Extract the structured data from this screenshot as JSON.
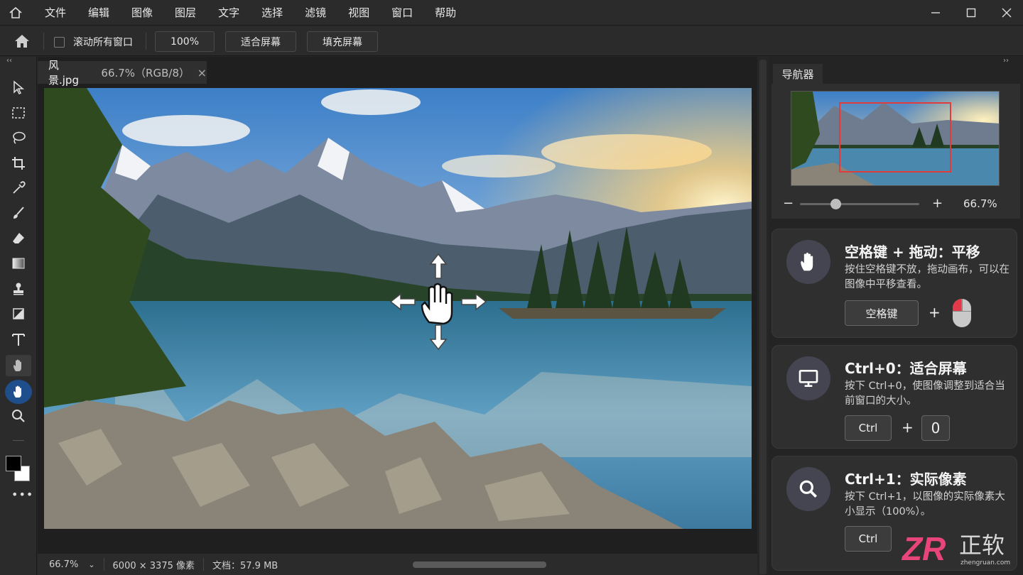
{
  "menubar": {
    "items": [
      "文件",
      "编辑",
      "图像",
      "图层",
      "文字",
      "选择",
      "滤镜",
      "视图",
      "窗口",
      "帮助"
    ]
  },
  "options": {
    "scroll_all_label": "滚动所有窗口",
    "zoom_value": "100%",
    "fit_screen_label": "适合屏幕",
    "fill_screen_label": "填充屏幕"
  },
  "document": {
    "tab_name": "风景.jpg",
    "tab_info": "66.7%（RGB/8）",
    "close_glyph": "×"
  },
  "status": {
    "zoom": "66.7%",
    "dimensions": "6000 × 3375 像素",
    "doc_size": "文档：57.9 MB"
  },
  "navigator": {
    "tab_label": "导航器",
    "zoom_minus": "−",
    "zoom_plus": "+",
    "zoom_value": "66.7%",
    "zoom_slider_fraction": 0.3
  },
  "cards": [
    {
      "title": "空格键 + 拖动：平移",
      "desc": "按住空格键不放，拖动画布，可以在图像中平移查看。",
      "key1": "空格键",
      "plus": "+"
    },
    {
      "title": "Ctrl+0：适合屏幕",
      "desc": "按下 Ctrl+0，使图像调整到适合当前窗口的大小。",
      "key1": "Ctrl",
      "plus": "+",
      "key2": "0"
    },
    {
      "title": "Ctrl+1：实际像素",
      "desc": "按下 Ctrl+1，以图像的实际像素大小显示（100%）。",
      "key1": "Ctrl"
    }
  ],
  "watermark": {
    "logo_text": "ZR",
    "brand_text": "正软",
    "url": "zhengruan.com"
  },
  "colors": {
    "accent_navigator_box": "#e03c3c",
    "active_tool_bg": "#1f4e8c"
  }
}
